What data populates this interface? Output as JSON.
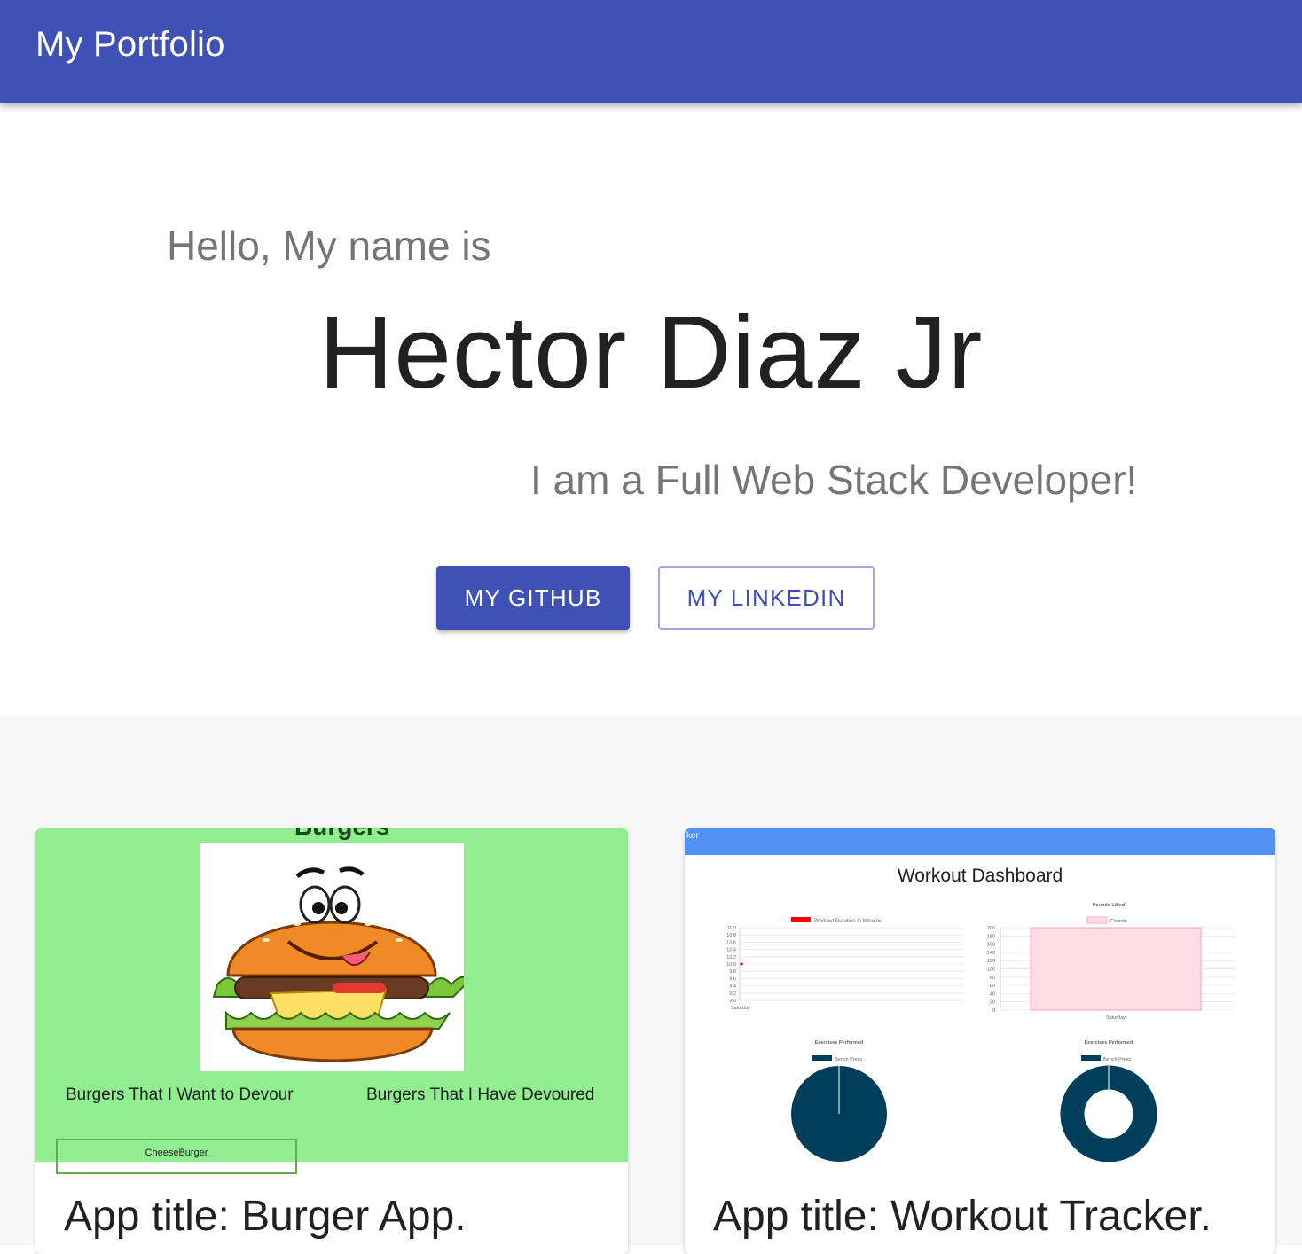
{
  "appbar": {
    "title": "My Portfolio"
  },
  "hero": {
    "greeting": "Hello, My name is",
    "name": "Hector Diaz Jr",
    "role": "I am a Full Web Stack Developer!",
    "github_label": "MY GITHUB",
    "linkedin_label": "MY LINKEDIN"
  },
  "projects": [
    {
      "title": "App title: Burger App.",
      "preview": {
        "header": "Burgers",
        "left_column": "Burgers That I Want to Devour",
        "right_column": "Burgers That I Have Devoured",
        "item": "CheeseBurger",
        "background": "#90ee90"
      }
    },
    {
      "title": "App title: Workout Tracker.",
      "preview": {
        "navbar_text": "ker",
        "heading": "Workout Dashboard",
        "line_chart": {
          "legend": "Workout Duration In Minutes",
          "y_ticks": [
            "11.0",
            "10.8",
            "10.6",
            "10.4",
            "10.2",
            "10.0",
            "9.8",
            "9.6",
            "9.4",
            "9.2",
            "9.0"
          ],
          "x_label": "Saturday",
          "value": 10
        },
        "bar_chart": {
          "title": "Pounds Lifted",
          "legend": "Pounds",
          "y_ticks": [
            "200",
            "180",
            "160",
            "140",
            "120",
            "100",
            "80",
            "60",
            "40",
            "20",
            "0"
          ],
          "x_label": "Saturday",
          "value": 200
        },
        "pie_chart": {
          "title": "Exercises Performed",
          "legend": "Bench Press"
        },
        "donut_chart": {
          "title": "Exercises Performed",
          "legend": "Bench Press"
        },
        "colors": {
          "navbar": "#5190f5",
          "pie": "#003f5c",
          "line_point": "#ff0000",
          "bar_fill": "#ffdde4",
          "bar_stroke": "#ff9fb4"
        }
      }
    }
  ]
}
